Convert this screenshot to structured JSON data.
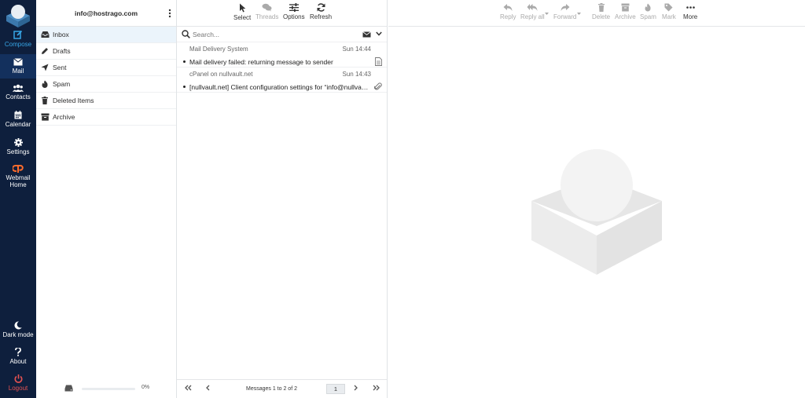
{
  "taskmenu": {
    "items": [
      {
        "label": "Compose"
      },
      {
        "label": "Mail"
      },
      {
        "label": "Contacts"
      },
      {
        "label": "Calendar"
      },
      {
        "label": "Settings"
      },
      {
        "label": "Webmail",
        "label2": "Home"
      }
    ],
    "bottom": [
      {
        "label": "Dark mode"
      },
      {
        "label": "About"
      },
      {
        "label": "Logout"
      }
    ]
  },
  "account": {
    "email": "info@hostrago.com"
  },
  "folders": [
    {
      "label": "Inbox",
      "icon": "inbox-icon"
    },
    {
      "label": "Drafts",
      "icon": "pencil-icon"
    },
    {
      "label": "Sent",
      "icon": "send-icon"
    },
    {
      "label": "Spam",
      "icon": "fire-icon"
    },
    {
      "label": "Deleted Items",
      "icon": "trash-icon"
    },
    {
      "label": "Archive",
      "icon": "archive-icon"
    }
  ],
  "quota": {
    "text": "0%"
  },
  "list_toolbar": {
    "select": "Select",
    "threads": "Threads",
    "options": "Options",
    "refresh": "Refresh"
  },
  "search": {
    "placeholder": "Search..."
  },
  "messages": [
    {
      "from": "Mail Delivery System",
      "date": "Sun 14:44",
      "subject": "Mail delivery failed: returning message to sender"
    },
    {
      "from": "cPanel on nullvault.net",
      "date": "Sun 14:43",
      "subject": "[nullvault.net] Client configuration settings for “info@nullvault.net”"
    }
  ],
  "pager": {
    "text": "Messages 1 to 2 of 2",
    "page": "1"
  },
  "message_toolbar": {
    "reply": "Reply",
    "reply_all": "Reply all",
    "forward": "Forward",
    "delete": "Delete",
    "archive": "Archive",
    "spam": "Spam",
    "mark": "Mark",
    "more": "More"
  },
  "colors": {
    "taskmenu_bg": "#0e1f3d",
    "accent": "#37a5e6",
    "logout": "#e55252",
    "selected_folder_bg": "#ebf4fb"
  }
}
